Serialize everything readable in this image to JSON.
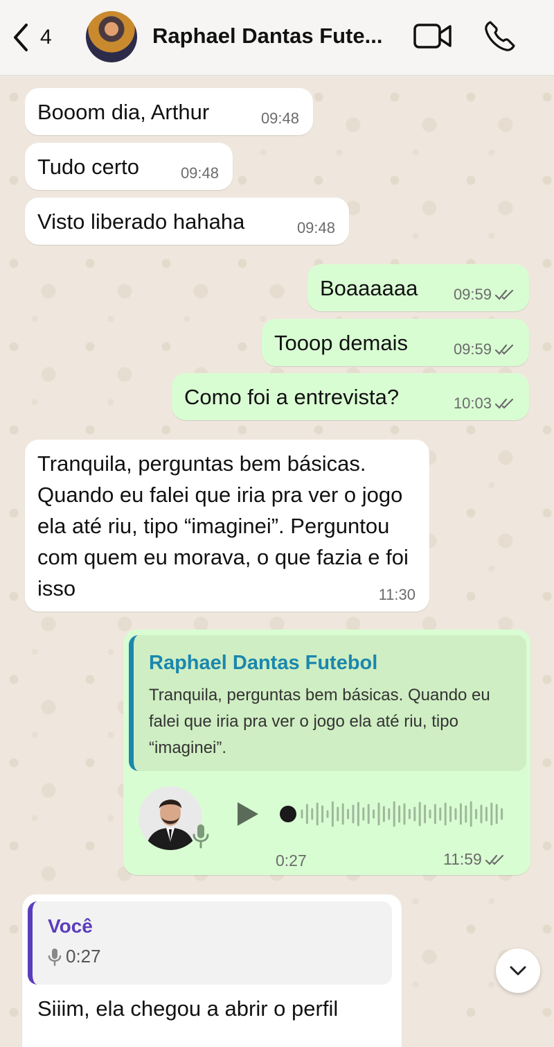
{
  "header": {
    "back_count": "4",
    "contact_name": "Raphael Dantas Fute..."
  },
  "messages": [
    {
      "text": "Booom dia, Arthur",
      "time": "09:48",
      "direction": "in"
    },
    {
      "text": "Tudo certo",
      "time": "09:48",
      "direction": "in"
    },
    {
      "text": "Visto liberado hahaha",
      "time": "09:48",
      "direction": "in"
    },
    {
      "text": "Boaaaaaa",
      "time": "09:59",
      "direction": "out"
    },
    {
      "text": "Tooop demais",
      "time": "09:59",
      "direction": "out"
    },
    {
      "text": "Como foi a entrevista?",
      "time": "10:03",
      "direction": "out"
    },
    {
      "text": "Tranquila, perguntas bem básicas. Quando eu falei que iria pra ver o jogo ela até riu, tipo “imaginei”. Perguntou com quem eu morava, o que fazia e foi isso",
      "time": "11:30",
      "direction": "in"
    }
  ],
  "voice_reply": {
    "quote_author": "Raphael Dantas Futebol",
    "quote_text": "Tranquila, perguntas bem básicas. Quando eu falei que iria pra ver o jogo ela até riu, tipo “imaginei”.",
    "duration": "0:27",
    "time": "11:59",
    "progress": 0
  },
  "last_message": {
    "quote_author": "Você",
    "quote_duration": "0:27",
    "text": "Siiim, ela chegou a abrir o perfil"
  },
  "colors": {
    "outgoing_bubble": "#d9fdd3",
    "incoming_bubble": "#ffffff",
    "read_check": "#6b6b6b",
    "quote_accent": "#1b87ad",
    "you_accent": "#5a3dbb"
  }
}
